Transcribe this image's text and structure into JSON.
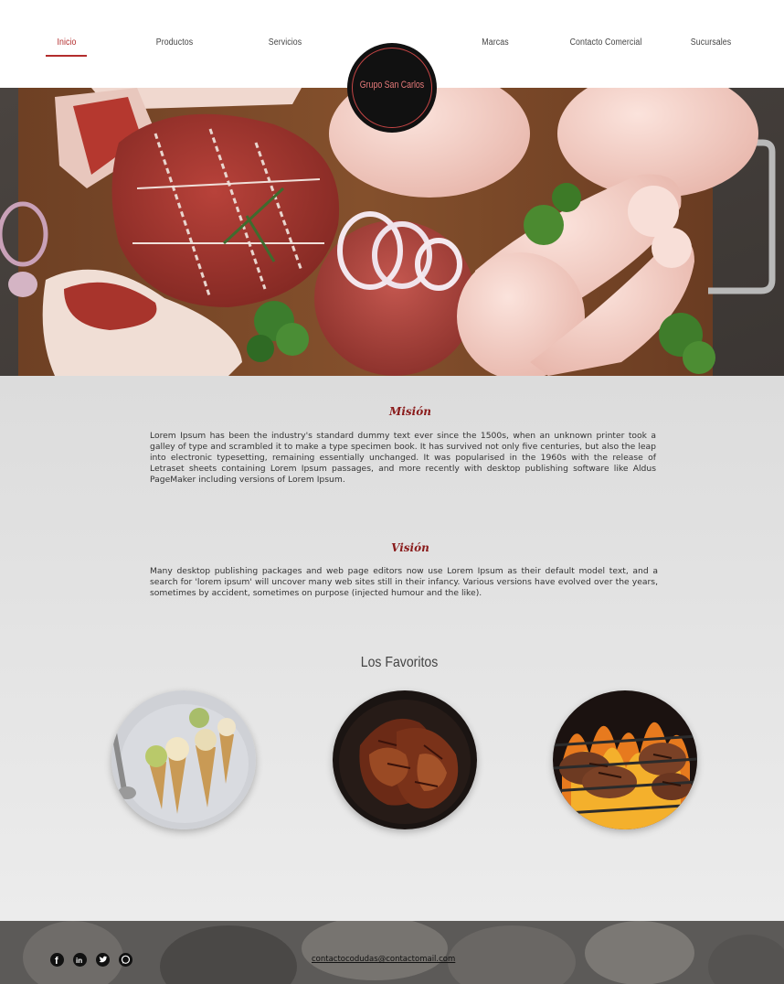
{
  "nav": {
    "items": [
      {
        "label": "Inicio",
        "active": true
      },
      {
        "label": "Productos"
      },
      {
        "label": "Servicios"
      },
      {
        "label": "Marcas"
      },
      {
        "label": "Contacto Comercial"
      },
      {
        "label": "Sucursales"
      }
    ]
  },
  "logo": {
    "text": "Grupo San Carlos"
  },
  "mision": {
    "title": "Misión",
    "text": "Lorem Ipsum has been the industry's standard dummy text ever since the 1500s, when an unknown printer took a galley of type and scrambled it to make a type specimen book. It has survived not only five centuries, but also the leap into electronic typesetting, remaining essentially unchanged. It was popularised in the 1960s with the release of Letraset sheets containing Lorem Ipsum passages, and more recently with desktop publishing software like Aldus PageMaker including versions of Lorem Ipsum."
  },
  "vision": {
    "title": "Visión",
    "text": "Many desktop publishing packages and web page editors now use Lorem Ipsum as their default model text, and a search for 'lorem ipsum' will uncover many web sites still in their infancy. Various versions have evolved over the years, sometimes by accident, sometimes on purpose (injected humour and the like)."
  },
  "favorites": {
    "title": "Los Favoritos"
  },
  "footer": {
    "email": "contactocodudas@contactomail.com"
  },
  "colors": {
    "accent": "#b32c2c",
    "heading": "#8a1b1b"
  }
}
